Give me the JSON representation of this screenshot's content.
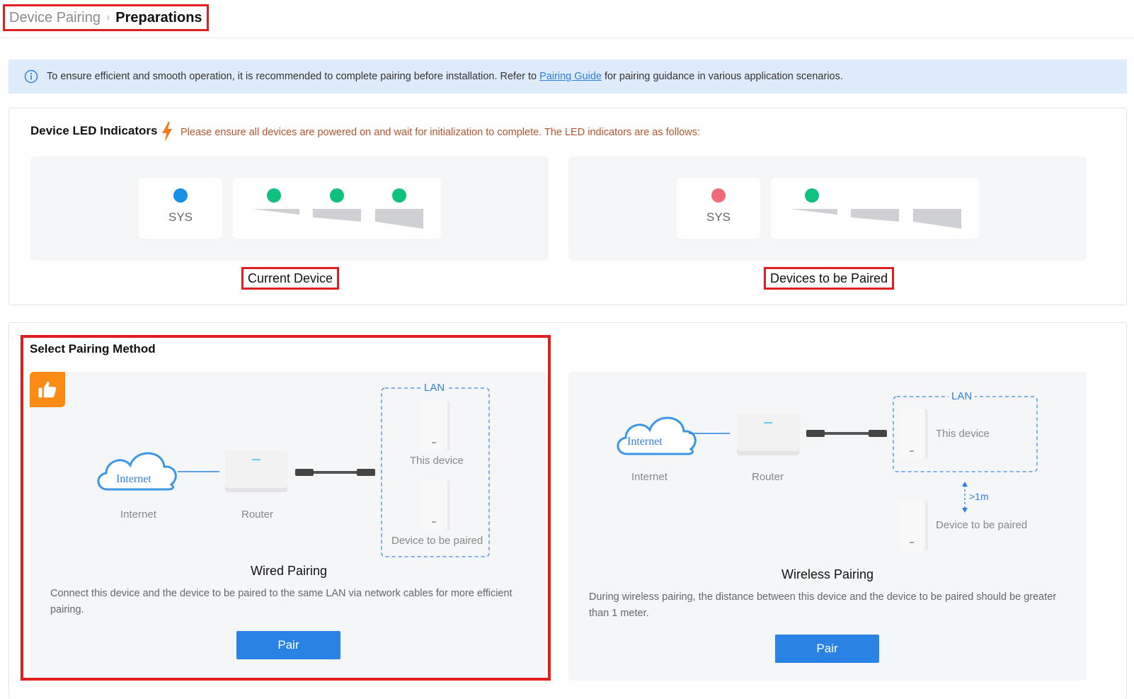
{
  "breadcrumb": {
    "parent": "Device Pairing",
    "current": "Preparations"
  },
  "notice": {
    "icon": "info-icon",
    "text_before": "To ensure efficient and smooth operation, it is recommended to complete pairing before installation. Refer to",
    "link": "Pairing Guide",
    "text_after": "for pairing guidance in various application scenarios."
  },
  "led": {
    "title": "Device LED Indicators",
    "icon": "lightning-icon",
    "note": "Please ensure all devices are powered on and wait for initialization to complete. The LED indicators are as follows:",
    "panels": [
      {
        "caption": "Current Device",
        "sys_label": "SYS",
        "sys_color": "#1890e8",
        "signal_colors": [
          "#10c07e",
          "#10c07e",
          "#10c07e"
        ]
      },
      {
        "caption": "Devices to be Paired",
        "sys_label": "SYS",
        "sys_color": "#f26b7a",
        "signal_colors": [
          "#10c07e",
          "",
          ""
        ]
      }
    ]
  },
  "pairing": {
    "title": "Select Pairing Method",
    "wired": {
      "recommended_icon": "thumbs-up-icon",
      "internet_cloud": "Internet",
      "internet_label": "Internet",
      "router_label": "Router",
      "lan_label": "LAN",
      "this_device_label": "This device",
      "device_to_pair_label": "Device to be paired",
      "title": "Wired Pairing",
      "description": "Connect this device and the device to be paired to the same LAN via network cables for more efficient pairing.",
      "button": "Pair"
    },
    "wireless": {
      "internet_cloud": "Internet",
      "internet_label": "Internet",
      "router_label": "Router",
      "lan_label": "LAN",
      "this_device_label": "This device",
      "distance_label": ">1m",
      "device_to_pair_label": "Device to be paired",
      "title": "Wireless Pairing",
      "description": "During wireless pairing, the distance between this device and the device to be paired should be greater than 1 meter.",
      "button": "Pair"
    }
  },
  "colors": {
    "accent": "#2a82e4",
    "highlight": "#e02020",
    "warning": "#b2552c",
    "badge": "#fa8c16"
  }
}
